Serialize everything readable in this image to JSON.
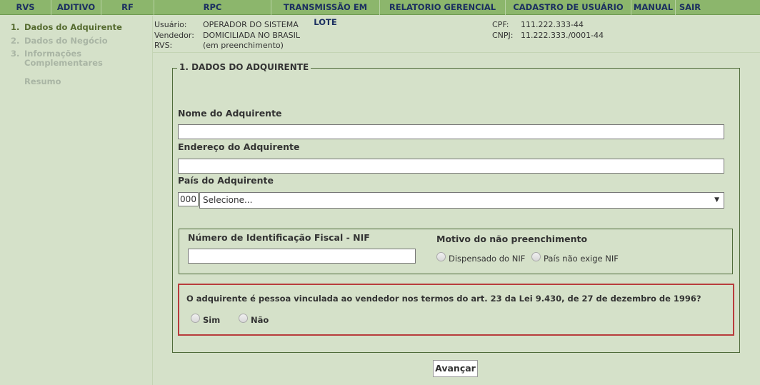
{
  "nav": [
    {
      "label": "RVS"
    },
    {
      "label": "ADITIVO"
    },
    {
      "label": "RF"
    },
    {
      "label": "RPC"
    },
    {
      "label": "TRANSMISSÃO EM LOTE"
    },
    {
      "label": "RELATORIO GERENCIAL"
    },
    {
      "label": "CADASTRO DE USUÁRIO"
    },
    {
      "label": "MANUAL"
    },
    {
      "label": "SAIR"
    }
  ],
  "steps": [
    {
      "num": "1.",
      "label": "Dados do Adquirente"
    },
    {
      "num": "2.",
      "label": "Dados do Negócio"
    },
    {
      "num": "3.",
      "label": "Informações",
      "label2": "Complementares"
    },
    {
      "num": "",
      "label": "Resumo"
    }
  ],
  "header": {
    "usuario_label": "Usuário:",
    "usuario": "OPERADOR DO SISTEMA",
    "vendedor_label": "Vendedor:",
    "vendedor": "DOMICILIADA NO BRASIL",
    "rvs_label": "RVS:",
    "rvs": "(em preenchimento)",
    "cpf_label": "CPF:",
    "cpf": "111.222.333-44",
    "cnpj_label": "CNPJ:",
    "cnpj": "11.222.333./0001-44"
  },
  "form": {
    "legend": "1. DADOS DO ADQUIRENTE",
    "nome_label": "Nome do Adquirente",
    "nome_value": "",
    "endereco_label": "Endereço do Adquirente",
    "endereco_value": "",
    "pais_label": "País do Adquirente",
    "pais_code": "000",
    "pais_selected": "Selecione...",
    "nif_label": "Número de Identificação Fiscal - NIF",
    "nif_value": "",
    "motivo_label": "Motivo do não preenchimento",
    "motivo_opt1": "Dispensado do NIF",
    "motivo_opt2": "País não exige NIF",
    "vinculo_question": "O adquirente é pessoa vinculada ao vendedor nos termos do art. 23 da Lei 9.430, de 27 de dezembro de 1996?",
    "vinculo_sim": "Sim",
    "vinculo_nao": "Não"
  },
  "actions": {
    "avancar": "Avançar"
  },
  "colors": {
    "nav_bg": "#8cb66c",
    "nav_text": "#1b2f60",
    "page_bg": "#d5e1c9",
    "highlight_border": "#b83c3c",
    "active_step": "#556b2f"
  }
}
